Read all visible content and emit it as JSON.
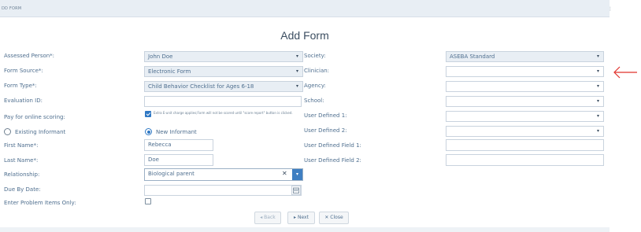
{
  "window": {
    "title": "DD FORM",
    "menu_glyph": "⋮"
  },
  "page": {
    "title": "Add Form"
  },
  "left": {
    "assessed_person": {
      "label": "Assessed Person*:",
      "value": "John Doe"
    },
    "form_source": {
      "label": "Form Source*:",
      "value": "Electronic Form"
    },
    "form_type": {
      "label": "Form Type*:",
      "value": "Child Behavior Checklist for Ages 6-18"
    },
    "evaluation_id": {
      "label": "Evaluation ID:",
      "value": ""
    },
    "pay_online": {
      "label": "Pay for online scoring:",
      "note": "Extra E-unit charge applies;Form will not be scored until \"score report\" button is clicked.",
      "checked": true
    },
    "existing_informant": {
      "label": "Existing Informant"
    },
    "new_informant": {
      "label": "New Informant"
    },
    "first_name": {
      "label": "First Name*:",
      "value": "Rebecca"
    },
    "last_name": {
      "label": "Last Name*:",
      "value": "Doe"
    },
    "relationship": {
      "label": "Relationship:",
      "value": "Biological parent"
    },
    "due_by_date": {
      "label": "Due By Date:",
      "value": ""
    },
    "problem_items": {
      "label": "Enter Problem Items Only:",
      "checked": false
    }
  },
  "right": {
    "society": {
      "label": "Society:",
      "value": "ASEBA Standard"
    },
    "clinician": {
      "label": "Clinician:",
      "value": ""
    },
    "agency": {
      "label": "Agency:",
      "value": ""
    },
    "school": {
      "label": "School:",
      "value": ""
    },
    "user_defined_1": {
      "label": "User Defined 1:",
      "value": ""
    },
    "user_defined_2": {
      "label": "User Defined 2:",
      "value": ""
    },
    "user_defined_field_1": {
      "label": "User Defined Field 1:",
      "value": ""
    },
    "user_defined_field_2": {
      "label": "User Defined Field 2:",
      "value": ""
    }
  },
  "buttons": {
    "back": "◂ Back",
    "next": "▸ Next",
    "close": "✕ Close"
  },
  "colors": {
    "accent": "#2f78c4",
    "annotation_arrow": "#e0302a",
    "filled_field": "#e8eef4"
  },
  "icons": {
    "dropdown": "▾",
    "clear": "✕",
    "calendar": "calendar-icon"
  }
}
